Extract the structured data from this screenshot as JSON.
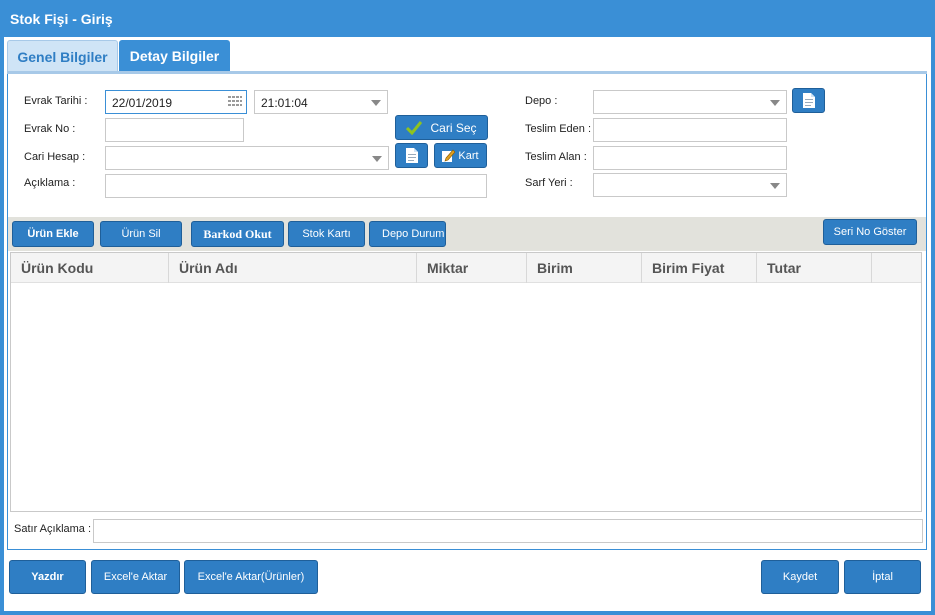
{
  "window": {
    "title": "Stok Fişi - Giriş"
  },
  "tabs": [
    {
      "label": "Genel Bilgiler"
    },
    {
      "label": "Detay Bilgiler"
    }
  ],
  "form": {
    "evrak_tarihi_label": "Evrak Tarihi :",
    "evrak_tarihi_value": "22/01/2019",
    "evrak_saati_value": "21:01:04",
    "evrak_no_label": "Evrak No :",
    "evrak_no_value": "",
    "cari_hesap_label": "Cari Hesap :",
    "cari_hesap_value": "",
    "aciklama_label": "Açıklama :",
    "aciklama_value": "",
    "cari_sec_label": "Cari Seç",
    "kart_label": "Kart",
    "depo_label": "Depo :",
    "depo_value": "",
    "teslim_eden_label": "Teslim Eden :",
    "teslim_eden_value": "",
    "teslim_alan_label": "Teslim Alan :",
    "teslim_alan_value": "",
    "sarf_yeri_label": "Sarf Yeri :",
    "sarf_yeri_value": ""
  },
  "toolbar": {
    "urun_ekle": "Ürün Ekle",
    "urun_sil": "Ürün Sil",
    "barkod_okut": "Barkod Okut",
    "stok_karti": "Stok Kartı",
    "depo_durumu": "Depo Durumu",
    "seri_no_goster": "Seri No Göster"
  },
  "grid": {
    "columns": [
      "Ürün Kodu",
      "Ürün Adı",
      "Miktar",
      "Birim",
      "Birim Fiyat",
      "Tutar"
    ],
    "rows": []
  },
  "satir": {
    "label": "Satır Açıklama :",
    "value": ""
  },
  "footer": {
    "yazdir": "Yazdır",
    "excel_aktar": "Excel'e Aktar",
    "excel_aktar_urunler": "Excel'e Aktar(Ürünler)",
    "kaydet": "Kaydet",
    "iptal": "İptal"
  },
  "colors": {
    "accent": "#3a8fd6",
    "button": "#2f7ec4",
    "check": "#8fc31f"
  },
  "icons": [
    "calendar-icon",
    "document-icon",
    "checkmark-icon",
    "edit-icon",
    "chevron-down-icon"
  ]
}
